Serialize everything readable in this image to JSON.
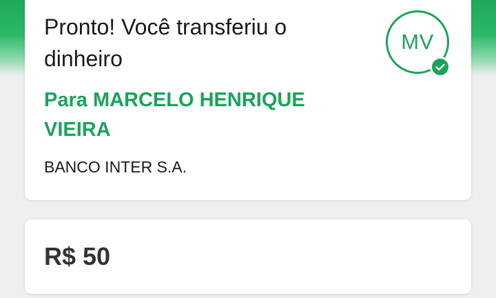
{
  "transfer": {
    "title": "Pronto! Você transferiu o dinheiro",
    "recipient_line": "Para MARCELO HENRIQUE VIEIRA",
    "bank_name": "BANCO INTER S.A.",
    "avatar_initials": "MV",
    "amount": "R$ 50",
    "status_icon": "check-icon"
  },
  "colors": {
    "accent": "#1aa35a",
    "header": "#2bb867",
    "background": "#efefef",
    "card": "#ffffff",
    "text": "#1a1a1a"
  }
}
